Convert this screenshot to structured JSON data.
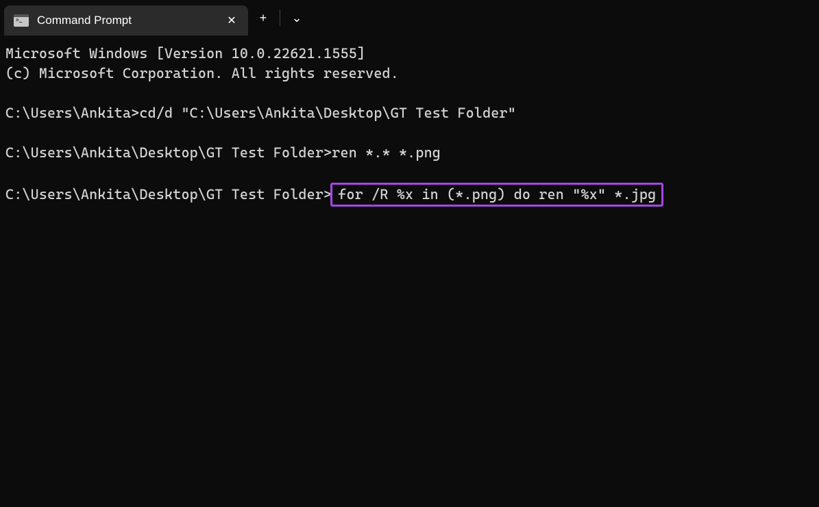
{
  "tab": {
    "title": "Command Prompt",
    "icon_name": "terminal-icon"
  },
  "controls": {
    "close": "✕",
    "new_tab": "+",
    "dropdown": "⌄"
  },
  "terminal": {
    "line1": "Microsoft Windows [Version 10.0.22621.1555]",
    "line2": "(c) Microsoft Corporation. All rights reserved.",
    "blank1": "",
    "prompt1": "C:\\Users\\Ankita>",
    "cmd1": "cd/d \"C:\\Users\\Ankita\\Desktop\\GT Test Folder\"",
    "blank2": "",
    "prompt2": "C:\\Users\\Ankita\\Desktop\\GT Test Folder>",
    "cmd2": "ren *.* *.png",
    "blank3": "",
    "prompt3": "C:\\Users\\Ankita\\Desktop\\GT Test Folder>",
    "cmd3": "for /R %x in (*.png) do ren \"%x\" *.jpg"
  }
}
